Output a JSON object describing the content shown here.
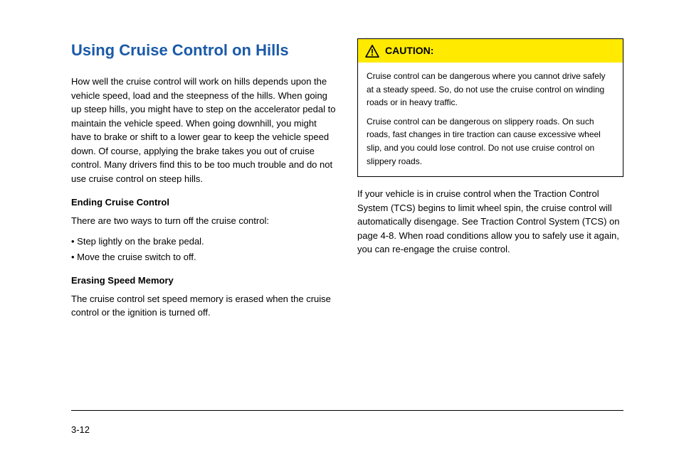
{
  "left": {
    "heading": "Using Cruise Control on Hills",
    "p1": "How well the cruise control will work on hills depends upon the vehicle speed, load and the steepness of the hills. When going up steep hills, you might have to step on the accelerator pedal to maintain the vehicle speed. When going downhill, you might have to brake or shift to a lower gear to keep the vehicle speed down. Of course, applying the brake takes you out of cruise control. Many drivers find this to be too much trouble and do not use cruise control on steep hills.",
    "sub": "Ending Cruise Control",
    "p2": "There are two ways to turn off the cruise control:",
    "b1": "• Step lightly on the brake pedal.",
    "b2": "• Move the cruise switch to off.",
    "sub2": "Erasing Speed Memory",
    "p3": "The cruise control set speed memory is erased when the cruise control or the ignition is turned off."
  },
  "right": {
    "callout": {
      "label": "CAUTION:",
      "body1": "Cruise control can be dangerous where you cannot drive safely at a steady speed. So, do not use the cruise control on winding roads or in heavy traffic.",
      "body2": "Cruise control can be dangerous on slippery roads. On such roads, fast changes in tire traction can cause excessive wheel slip, and you could lose control. Do not use cruise control on slippery roads."
    },
    "p1": "If your vehicle is in cruise control when the Traction Control System (TCS) begins to limit wheel spin, the cruise control will automatically disengage. See Traction Control System (TCS) on page 4-8. When road conditions allow you to safely use it again, you can re-engage the cruise control."
  },
  "pageNumber": "3-12"
}
